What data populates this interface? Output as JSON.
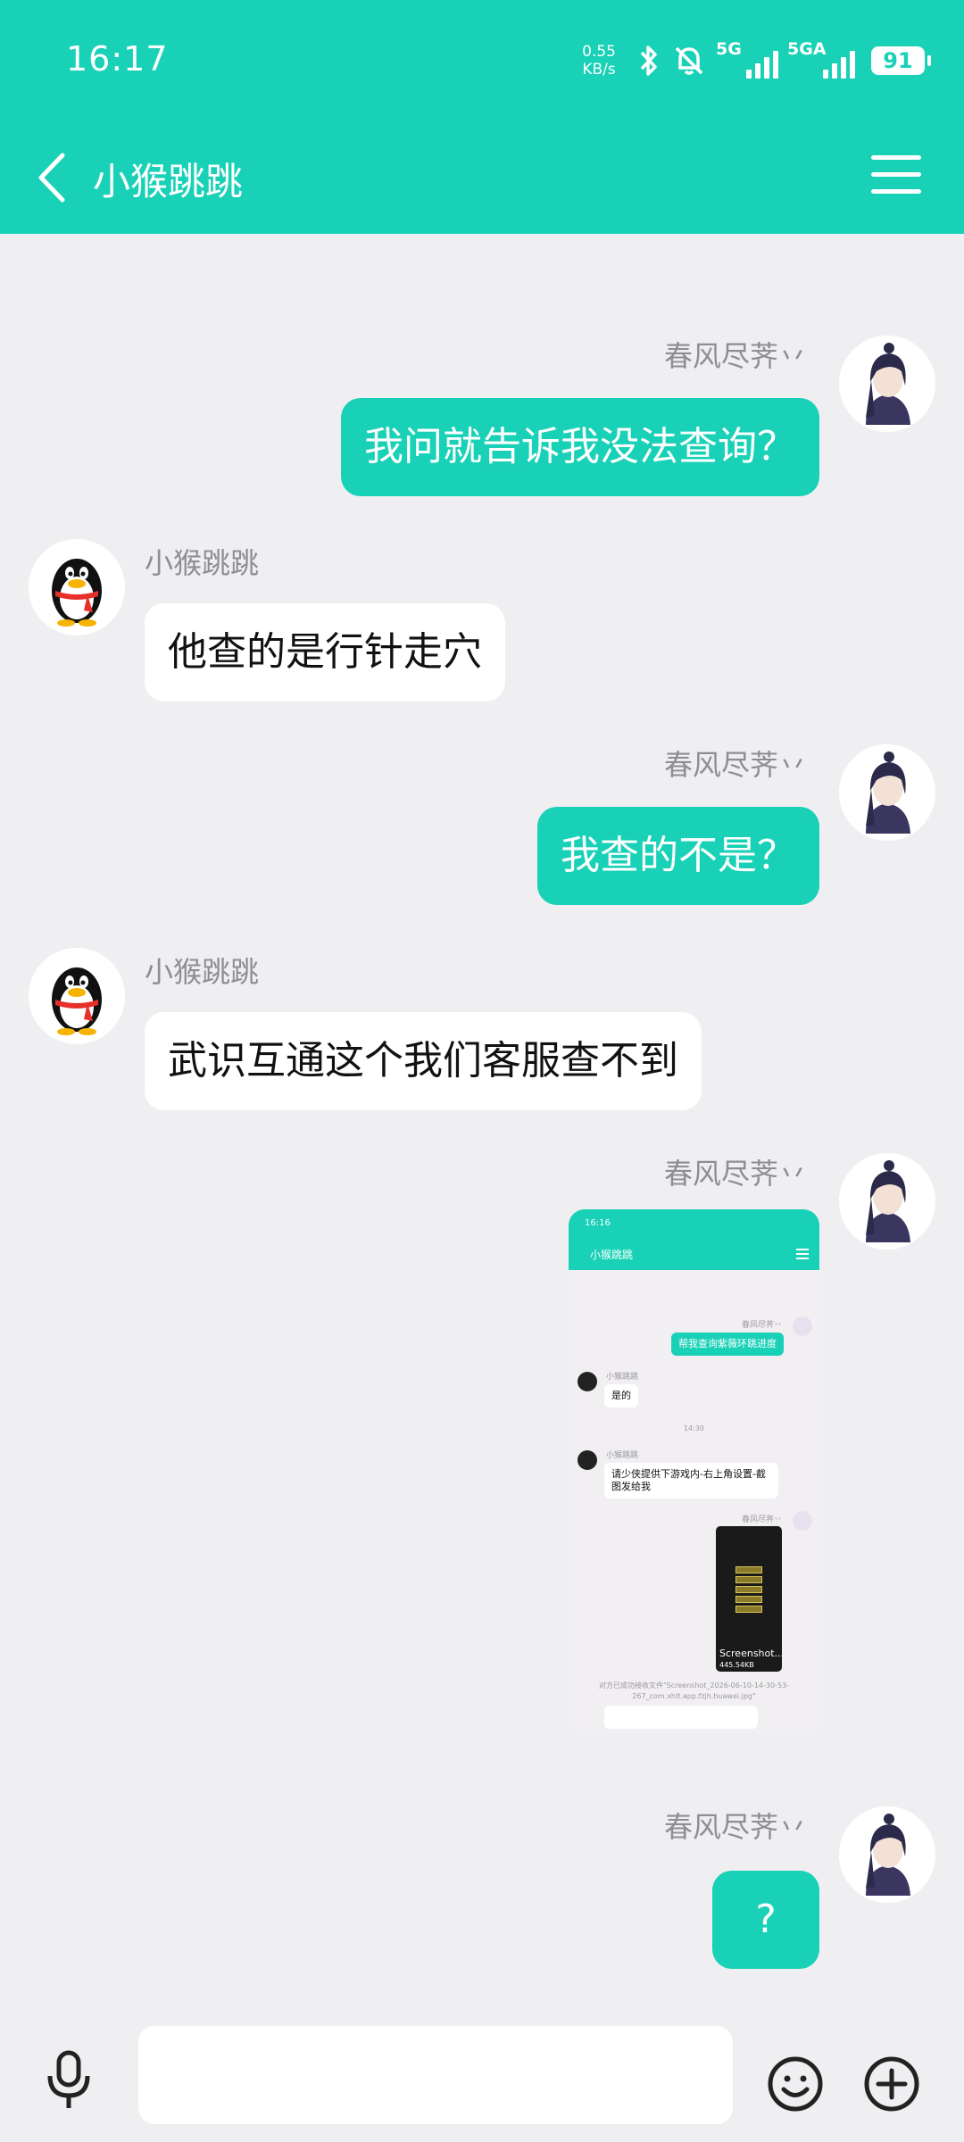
{
  "status_bar": {
    "time": "16:17",
    "net_speed_value": "0.55",
    "net_speed_unit": "KB/s",
    "signal1_label": "5G",
    "signal2_label": "5GA",
    "battery": "91"
  },
  "header": {
    "title": "小猴跳跳"
  },
  "messages": [
    {
      "sender": "春风尽荠丷",
      "text": "我问就告诉我没法查询？",
      "side": "me"
    },
    {
      "sender": "小猴跳跳",
      "text": "他查的是行针走穴",
      "side": "them"
    },
    {
      "sender": "春风尽荠丷",
      "text": "我查的不是？",
      "side": "me"
    },
    {
      "sender": "小猴跳跳",
      "text": "武识互通这个我们客服查不到",
      "side": "them"
    },
    {
      "sender": "春风尽荠丷",
      "type": "image",
      "side": "me"
    },
    {
      "sender": "春风尽荠丷",
      "text": "?",
      "side": "me"
    }
  ],
  "embedded_screenshot": {
    "time": "16:16",
    "title": "小猴跳跳",
    "me_name": "春风尽荠丷",
    "them_name": "小猴跳跳",
    "msg1": "帮我查询紫薇环跳进度",
    "msg2": "是的",
    "time_divider": "14:30",
    "msg3": "请少侠提供下游戏内-右上角设置-截图发给我",
    "file_label": "Screenshot...",
    "file_size": "445.54KB",
    "notice": "对方已成功接收文件\"Screenshot_2026-06-10-14-30-53-267_com.xhlt.app.fzjh.huawei.jpg\""
  },
  "input": {
    "placeholder": ""
  },
  "colors": {
    "accent": "#18d1b6",
    "background": "#efeff2"
  }
}
